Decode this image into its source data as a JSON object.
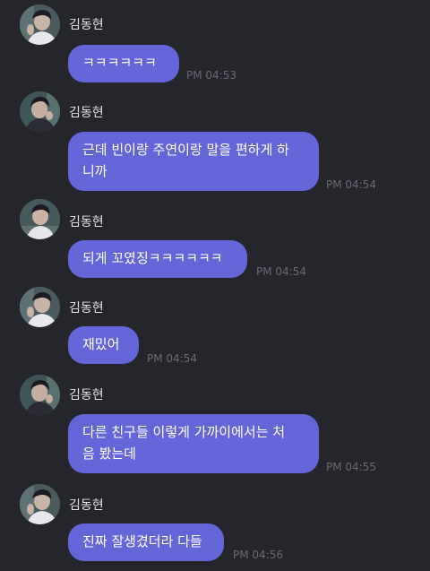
{
  "messages": [
    {
      "sender": "김동현",
      "text": "ㅋㅋㅋㅋㅋㅋ",
      "time": "PM 04:53"
    },
    {
      "sender": "김동현",
      "text": "근데 빈이랑 주연이랑 말을 편하게 하\n니까",
      "time": "PM 04:54"
    },
    {
      "sender": "김동현",
      "text": "되게 꼬였징ㅋㅋㅋㅋㅋㅋ",
      "time": "PM 04:54"
    },
    {
      "sender": "김동현",
      "text": "재밌어",
      "time": "PM 04:54"
    },
    {
      "sender": "김동현",
      "text": "다른 친구들 이렇게 가까이에서는 처\n음 봤는데",
      "time": "PM 04:55"
    },
    {
      "sender": "김동현",
      "text": "진짜 잘생겼더라 다들",
      "time": "PM 04:56"
    }
  ],
  "colors": {
    "background": "#25252c",
    "bubble": "#6466d8",
    "bubble_text": "#ffffff",
    "sender_text": "#e4e4ea",
    "time_text": "#6a6a74"
  },
  "icons": {
    "avatar": "profile-photo"
  }
}
